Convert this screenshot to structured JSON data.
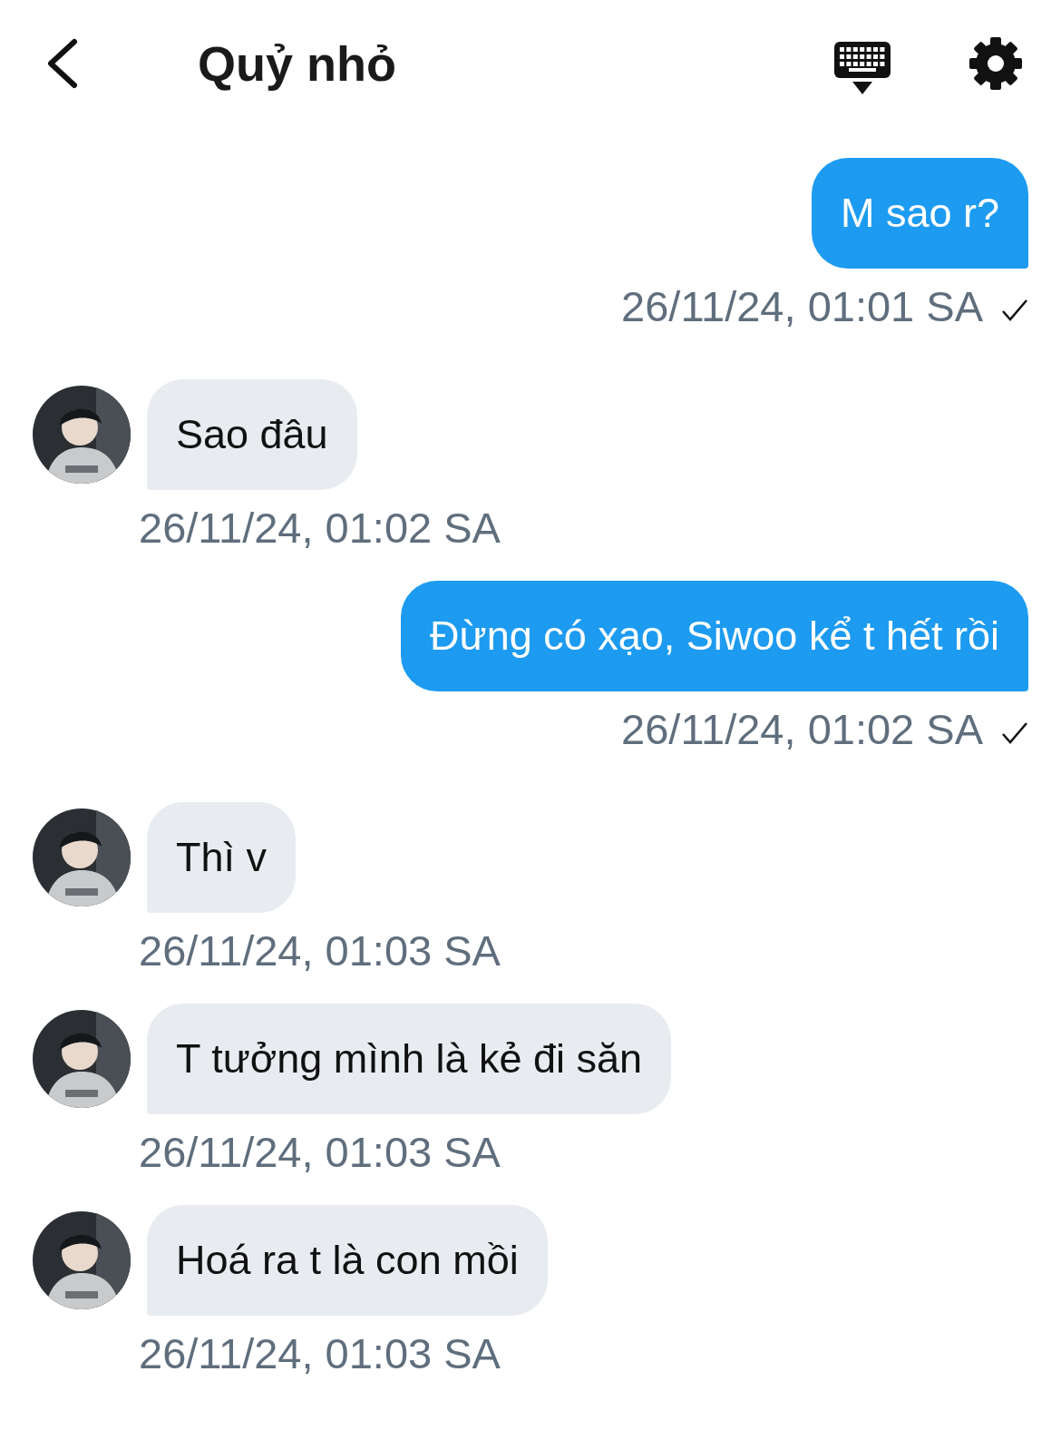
{
  "header": {
    "title": "Quỷ nhỏ"
  },
  "messages": [
    {
      "kind": "sent",
      "text": "M sao r?",
      "time": "26/11/24, 01:01 SA",
      "delivered": true
    },
    {
      "kind": "received",
      "text": "Sao đâu",
      "time": "26/11/24, 01:02 SA"
    },
    {
      "kind": "sent",
      "text": "Đừng có xạo, Siwoo kể t hết rồi",
      "time": "26/11/24, 01:02 SA",
      "delivered": true
    },
    {
      "kind": "received",
      "text": "Thì v",
      "time": "26/11/24, 01:03 SA"
    },
    {
      "kind": "received",
      "text": "T tưởng mình là kẻ đi săn",
      "time": "26/11/24, 01:03 SA"
    },
    {
      "kind": "received",
      "text": "Hoá ra t là con mồi",
      "time": "26/11/24, 01:03 SA"
    }
  ]
}
